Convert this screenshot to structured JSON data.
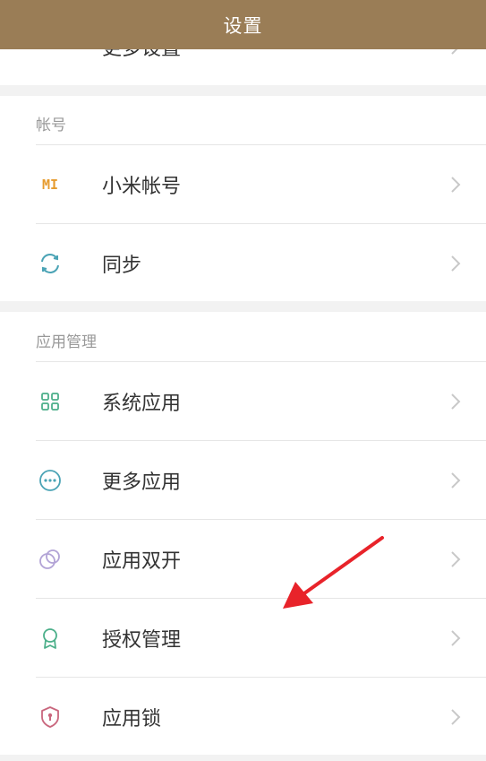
{
  "header": {
    "title": "设置"
  },
  "top_partial": {
    "label": "更多设置"
  },
  "account_section": {
    "title": "帐号",
    "items": [
      {
        "label": "小米帐号",
        "icon": "mi-logo-icon",
        "mi_text": "MI"
      },
      {
        "label": "同步",
        "icon": "sync-icon"
      }
    ]
  },
  "app_section": {
    "title": "应用管理",
    "items": [
      {
        "label": "系统应用",
        "icon": "grid-apps-icon"
      },
      {
        "label": "更多应用",
        "icon": "more-dots-icon"
      },
      {
        "label": "应用双开",
        "icon": "dual-apps-icon"
      },
      {
        "label": "授权管理",
        "icon": "badge-icon"
      },
      {
        "label": "应用锁",
        "icon": "shield-lock-icon"
      }
    ]
  },
  "colors": {
    "header_bg": "#9a7d56",
    "mi_orange": "#e69b2e",
    "teal": "#4aa3b5",
    "green": "#4caf8a",
    "purple": "#b2a3d6",
    "pink": "#c9667d",
    "annotation_arrow": "#e8232a"
  }
}
